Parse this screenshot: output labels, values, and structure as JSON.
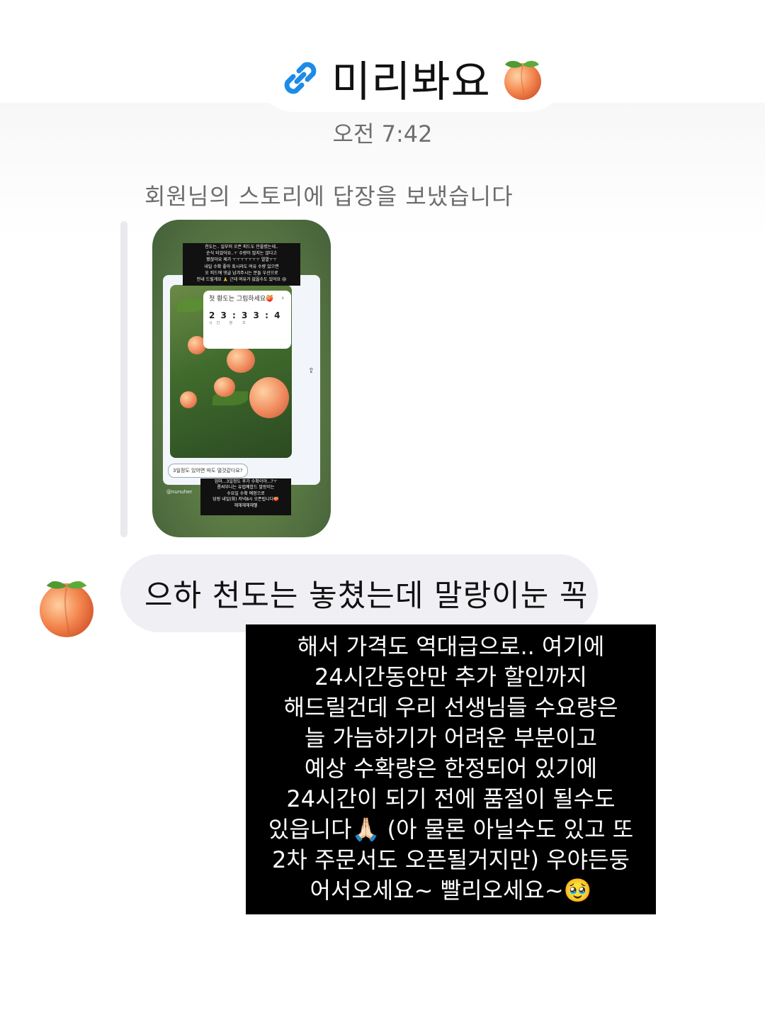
{
  "header": {
    "title": "미리봐요",
    "title_emoji_icon": "peach-emoji-icon",
    "link_icon": "link-icon",
    "link_icon_color": "#1d8be8"
  },
  "time": "오전 7:42",
  "reply_notice": "회원님의 스토리에 답장을 보냈습니다",
  "story": {
    "top_text_lines": [
      "천도는.. 일부러 오픈 피드도 안올렸는데..",
      "순식 되었어요..ㅜ 수량이 많지는 않다고",
      "봤잖아요 제가 ㅜㅜㅜㅜㅜㅜㅜ 열열ㅜㅜ",
      "내일 수확 좋아 혹시라도 여유 수량 있으면",
      "오 피드에 댓글 남겨주시는 분들 우선으로",
      "안내 드릴게요 🙏 근데 여유가 없을수도 있어요 😢"
    ],
    "timer_label": "첫 황도는 그림하세요🍑",
    "timer_digits": "2 3 : 3 3 : 4",
    "timer_units": "시간  분  초",
    "question": "3일정도 있어면 따도 댈것같다요?",
    "bottom_text_lines": [
      "엄마...3일정도 후가 수확이야...?ㅜ",
      "롬싸부니는 유럽예합드 말랑이는",
      "수요일 수확 예정으로",
      "당장 내일(화) 저녁8시 오픈됩니다🍑",
      "헤헤헤헤헤헿"
    ],
    "handle": "@nunuher"
  },
  "message": {
    "avatar_icon": "peach-avatar-icon",
    "bubble_text": "으하 천도는 놓쳤는데 말랑이눈 꼭"
  },
  "caption": {
    "lines": [
      "해서 가격도 역대급으로.. 여기에",
      "24시간동안만 추가 할인까지",
      "해드릴건데 우리 선생님들 수요량은",
      "늘 가늠하기가 어려운 부분이고",
      "예상 수확량은 한정되어 있기에",
      "24시간이 되기 전에 품절이 될수도",
      "있읍니다🙏🏻 (아 물론 아닐수도 있고 또",
      "2차 주문서도 오픈될거지만) 우야든둥",
      "어서오세요~ 빨리오세요~🥹"
    ]
  }
}
